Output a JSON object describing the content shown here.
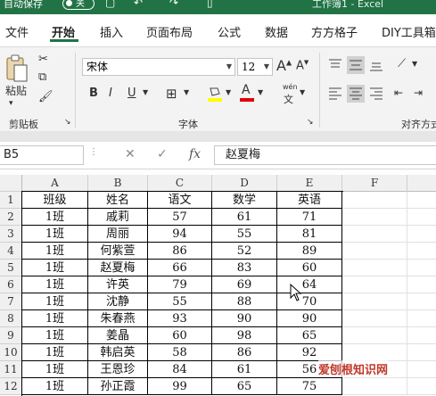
{
  "titlebar": {
    "autosave": "自动保存",
    "toggle": "关",
    "title": "工作簿1 - Excel"
  },
  "tabs": [
    {
      "label": "文件"
    },
    {
      "label": "开始"
    },
    {
      "label": "插入"
    },
    {
      "label": "页面布局"
    },
    {
      "label": "公式"
    },
    {
      "label": "数据"
    },
    {
      "label": "方方格子"
    },
    {
      "label": "DIY工具箱"
    }
  ],
  "ribbon": {
    "paste_label": "粘贴",
    "clipboard_group": "剪贴板",
    "font_name": "宋体",
    "font_size": "12",
    "grow_font": "A",
    "shrink_font": "A",
    "bold": "B",
    "italic": "I",
    "underline": "U",
    "font_color_glyph": "A",
    "phonetic_top": "wén",
    "phonetic_bottom": "文",
    "font_group": "字体",
    "align_group": "对齐方式"
  },
  "formula_bar": {
    "name_box": "B5",
    "cancel": "✕",
    "enter": "✓",
    "fx": "fx",
    "value": "赵夏梅"
  },
  "grid": {
    "columns": [
      "A",
      "B",
      "C",
      "D",
      "E",
      "F"
    ],
    "rows": [
      {
        "num": "1",
        "cells": [
          "班级",
          "姓名",
          "语文",
          "数学",
          "英语"
        ]
      },
      {
        "num": "2",
        "cells": [
          "1班",
          "戚莉",
          "57",
          "61",
          "71"
        ]
      },
      {
        "num": "3",
        "cells": [
          "1班",
          "周丽",
          "94",
          "55",
          "81"
        ]
      },
      {
        "num": "4",
        "cells": [
          "1班",
          "何紫萱",
          "86",
          "52",
          "89"
        ]
      },
      {
        "num": "5",
        "cells": [
          "1班",
          "赵夏梅",
          "66",
          "83",
          "60"
        ]
      },
      {
        "num": "6",
        "cells": [
          "1班",
          "许英",
          "79",
          "69",
          "64"
        ]
      },
      {
        "num": "7",
        "cells": [
          "1班",
          "沈静",
          "55",
          "88",
          "70"
        ]
      },
      {
        "num": "8",
        "cells": [
          "1班",
          "朱春燕",
          "93",
          "90",
          "90"
        ]
      },
      {
        "num": "9",
        "cells": [
          "1班",
          "姜晶",
          "60",
          "98",
          "65"
        ]
      },
      {
        "num": "10",
        "cells": [
          "1班",
          "韩启英",
          "58",
          "86",
          "92"
        ]
      },
      {
        "num": "11",
        "cells": [
          "1班",
          "王恩珍",
          "84",
          "61",
          "56"
        ]
      },
      {
        "num": "12",
        "cells": [
          "1班",
          "孙正霞",
          "99",
          "65",
          "75"
        ]
      }
    ]
  },
  "watermark": "爱刨根知识网",
  "colors": {
    "excel_green": "#217346",
    "font_color_bar": "#e00000",
    "highlight_bar": "#ffff00"
  }
}
